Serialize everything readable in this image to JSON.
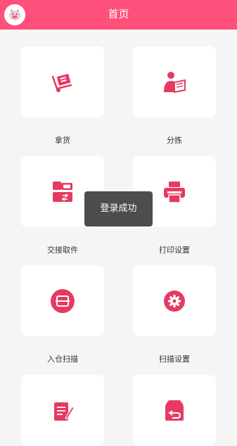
{
  "header": {
    "title": "首页",
    "color": "#ff4f7b"
  },
  "tiles": [
    {
      "label": "拿货",
      "icon": "hand-truck-icon"
    },
    {
      "label": "分拣",
      "icon": "person-reading-icon"
    },
    {
      "label": "交接取件",
      "icon": "exchange-icon"
    },
    {
      "label": "打印设置",
      "icon": "printer-icon"
    },
    {
      "label": "入仓扫描",
      "icon": "scan-icon"
    },
    {
      "label": "扫描设置",
      "icon": "gear-icon"
    },
    {
      "label": "",
      "icon": "notes-icon"
    },
    {
      "label": "",
      "icon": "return-box-icon"
    }
  ],
  "toast": {
    "text": "登录成功"
  },
  "colors": {
    "accent": "#e63a62",
    "background": "#f5f5f5"
  }
}
